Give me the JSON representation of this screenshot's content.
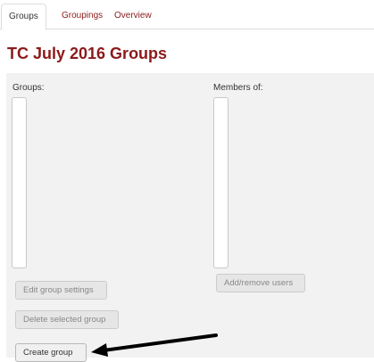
{
  "tabs": [
    {
      "label": "Groups",
      "active": true
    },
    {
      "label": "Groupings",
      "active": false
    },
    {
      "label": "Overview",
      "active": false
    }
  ],
  "page": {
    "title": "TC July 2016 Groups"
  },
  "groups_panel": {
    "label": "Groups:",
    "edit_button": "Edit group settings",
    "delete_button": "Delete selected group",
    "create_button": "Create group"
  },
  "members_panel": {
    "label": "Members of:",
    "add_remove_button": "Add/remove users"
  },
  "colors": {
    "accent": "#8b1a1a",
    "panel_background": "#f2f2f2",
    "annotation_arrow": "#000000"
  },
  "icons": {
    "annotation": "arrow-pointer-icon"
  }
}
